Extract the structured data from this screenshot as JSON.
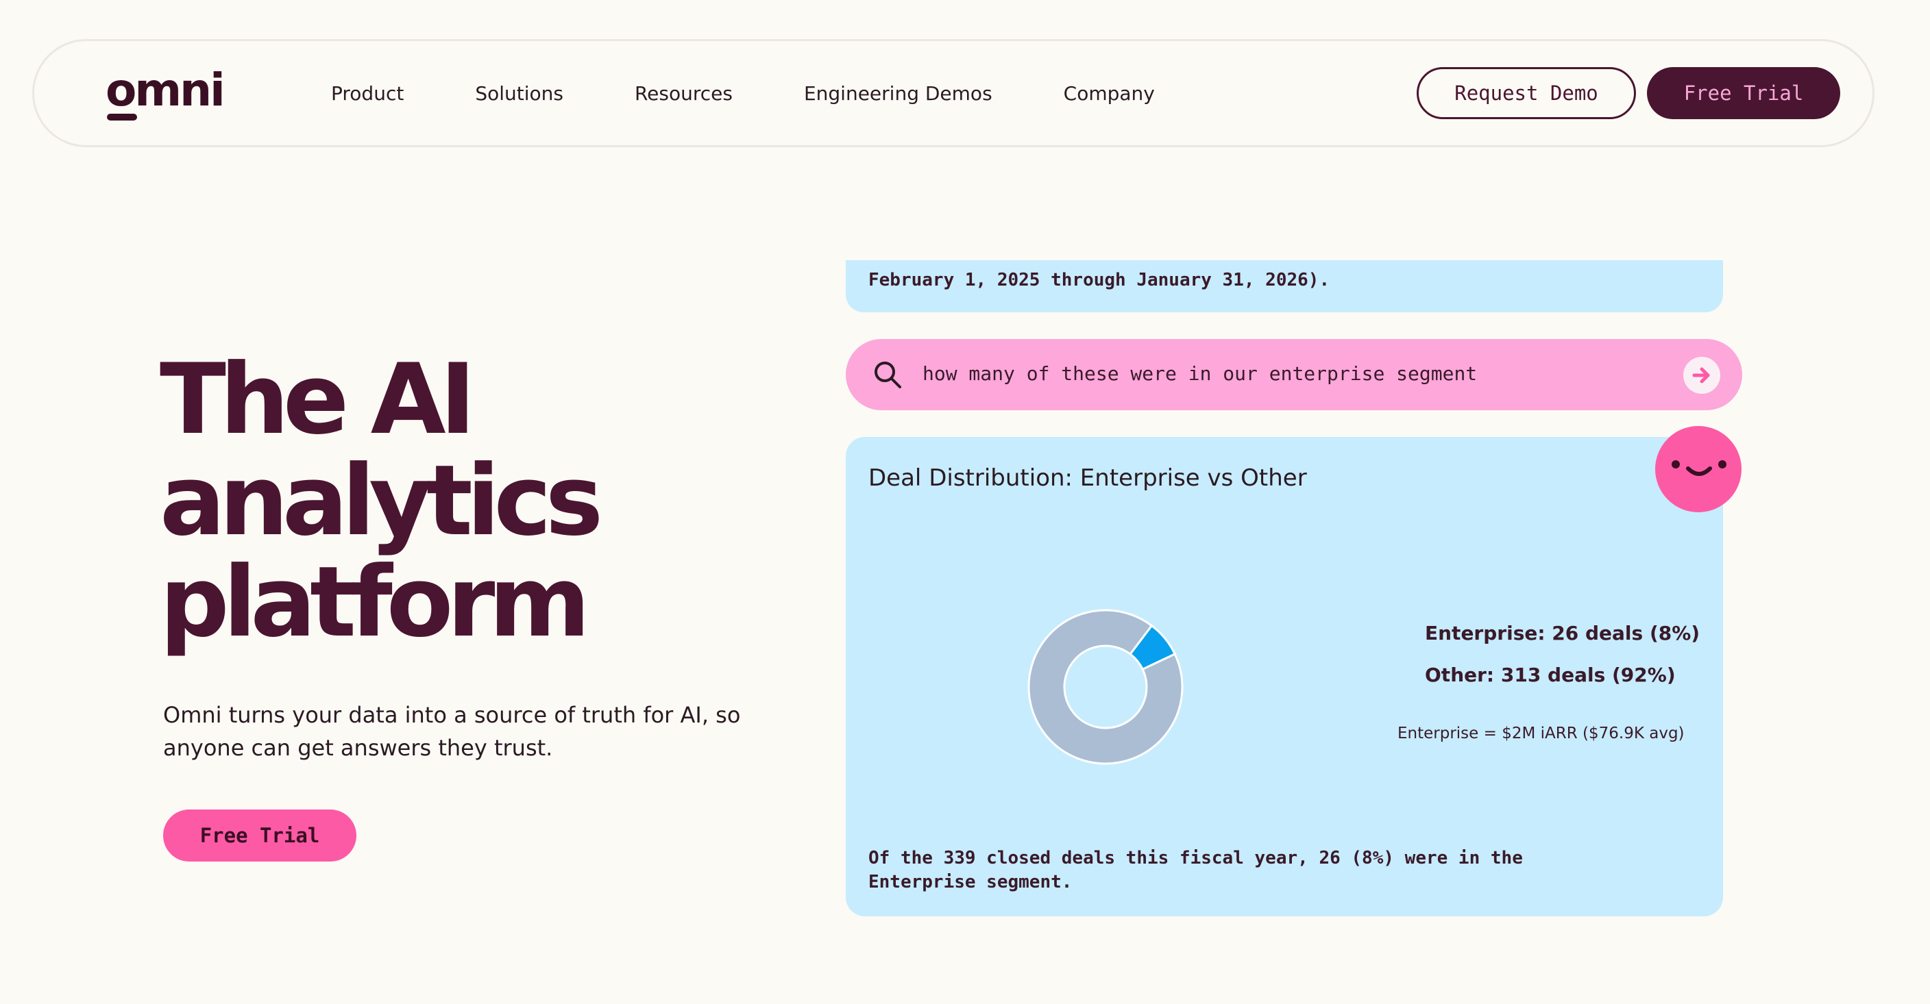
{
  "nav": {
    "logo_text": "omni",
    "links": [
      "Product",
      "Solutions",
      "Resources",
      "Engineering Demos",
      "Company"
    ],
    "request_demo_label": "Request Demo",
    "free_trial_label": "Free Trial"
  },
  "hero": {
    "title_lines": [
      "The AI",
      "analytics",
      "platform"
    ],
    "subtitle": "Omni turns your data into a source of truth for AI, so anyone can get answers they trust.",
    "cta_label": "Free Trial"
  },
  "chat": {
    "previous_answer_fragment": "February 1, 2025 through January 31, 2026).",
    "query_text": "how many of these were in our enterprise segment",
    "result": {
      "title": "Deal Distribution: Enterprise vs Other",
      "legend_enterprise": "Enterprise: 26 deals (8%)",
      "legend_other": "Other: 313 deals (92%)",
      "note": "Enterprise = $2M iARR ($76.9K avg)",
      "summary": "Of the 339 closed deals this fiscal year, 26 (8%) were in the Enterprise segment."
    }
  },
  "colors": {
    "brand": "#4a1530",
    "accent_pink": "#fd5aa5",
    "query_pink": "#fda7da",
    "card_blue": "#c7ecfd",
    "donut_other": "#aabdd3",
    "donut_enterprise": "#08a0ee"
  },
  "icons": {
    "search": "search-icon",
    "send": "arrow-right-icon",
    "assistant": "smiley-face-icon"
  },
  "chart_data": {
    "type": "pie",
    "title": "Deal Distribution: Enterprise vs Other",
    "categories": [
      "Enterprise",
      "Other"
    ],
    "values": [
      26,
      313
    ],
    "percentages": [
      8,
      92
    ],
    "donut": true
  }
}
